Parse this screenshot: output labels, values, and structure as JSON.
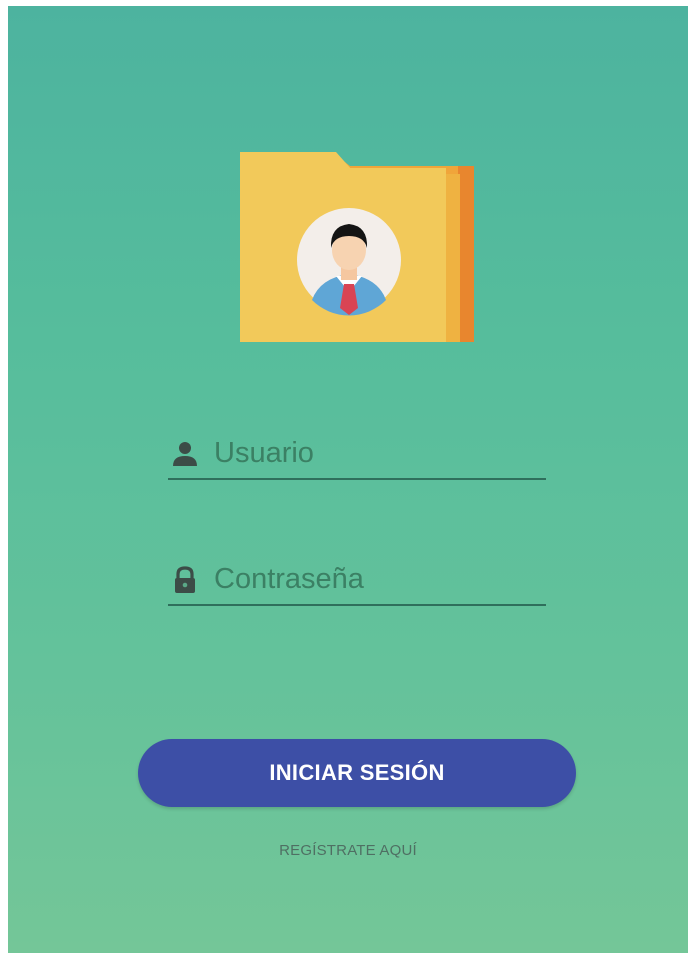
{
  "login": {
    "username_placeholder": "Usuario",
    "password_placeholder": "Contraseña",
    "login_button": "INICIAR SESIÓN",
    "register_link": "REGÍSTRATE AQUÍ"
  },
  "icons": {
    "logo": "folder-user-icon",
    "username": "person-icon",
    "password": "lock-icon"
  },
  "colors": {
    "background_top": "#4db39f",
    "background_bottom": "#74c698",
    "button": "#3d4fa6",
    "field_underline": "#2f6f5c",
    "folder": "#f2c95a"
  }
}
